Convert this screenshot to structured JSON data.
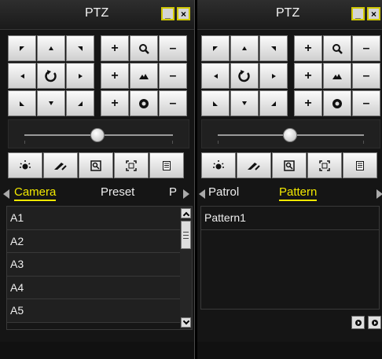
{
  "panels": [
    {
      "title": "PTZ",
      "window_buttons": {
        "minimize": "_",
        "close": "×"
      },
      "tabs": [
        "Camera",
        "Preset",
        "P"
      ],
      "active_tab": "Camera",
      "list": [
        "A1",
        "A2",
        "A3",
        "A4",
        "A5"
      ]
    },
    {
      "title": "PTZ",
      "window_buttons": {
        "minimize": "_",
        "close": "×"
      },
      "tabs": [
        "Patrol",
        "Pattern"
      ],
      "active_tab": "Pattern",
      "list": [
        "Pattern1"
      ]
    }
  ],
  "controls": {
    "plus": "+",
    "minus": "–"
  },
  "icons": {
    "direction_pad": [
      "up-left-arrow-icon",
      "up-arrow-icon",
      "up-right-arrow-icon",
      "left-arrow-icon",
      "auto-rotate-icon",
      "right-arrow-icon",
      "down-left-arrow-icon",
      "down-arrow-icon",
      "down-right-arrow-icon"
    ],
    "lens": [
      "zoom-icon",
      "focus-icon",
      "iris-icon"
    ],
    "toolbar": [
      "light-icon",
      "wiper-icon",
      "3d-zoom-icon",
      "center-icon",
      "menu-icon"
    ],
    "pattern_actions": [
      "play-icon",
      "record-icon"
    ]
  },
  "colors": {
    "accent": "#f2e800",
    "button_face": "#e6e6e6"
  }
}
